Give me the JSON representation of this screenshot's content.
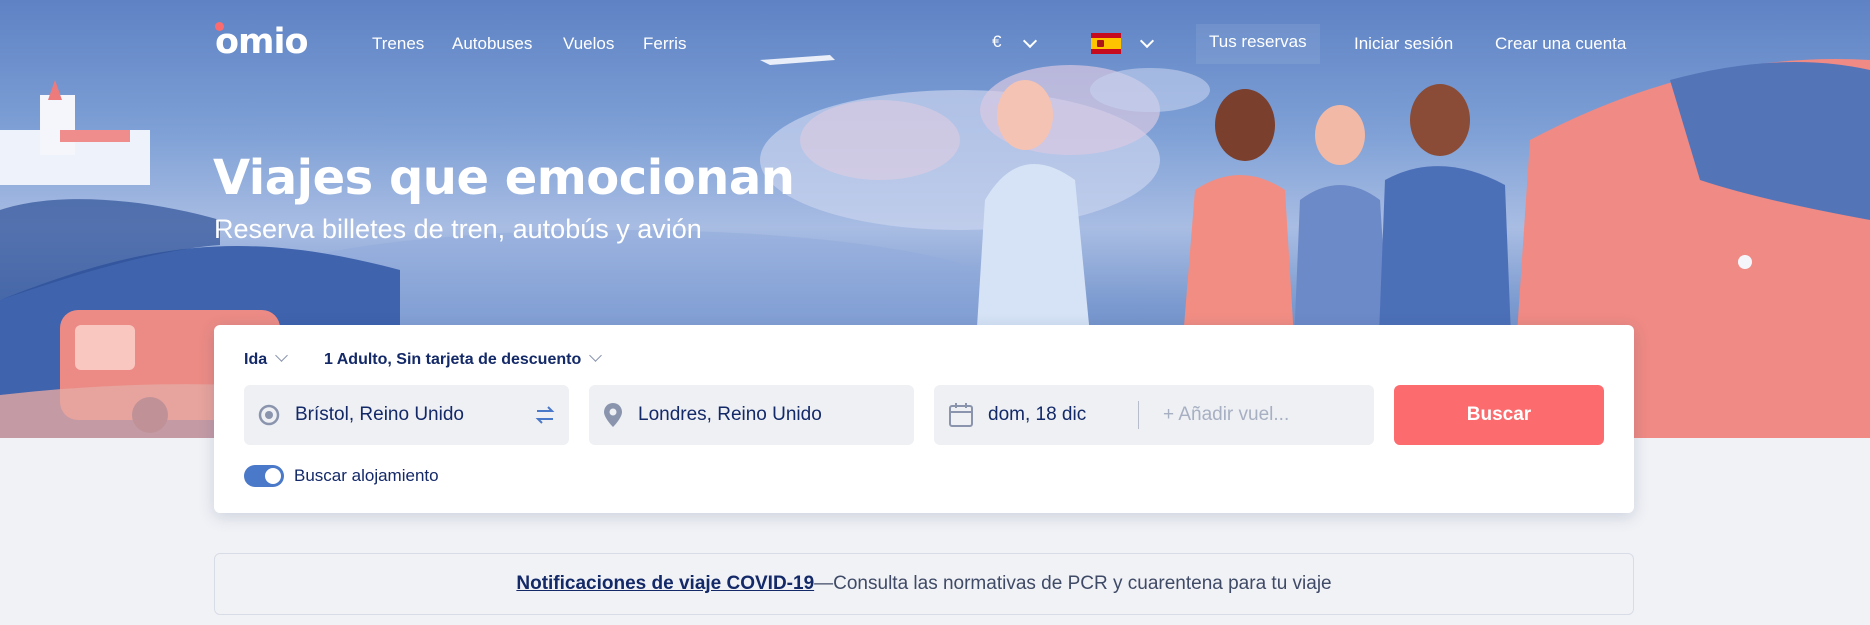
{
  "brand": {
    "name": "omio",
    "accent": "#fc6c6e",
    "navy": "#132968"
  },
  "nav": {
    "links": [
      "Trenes",
      "Autobuses",
      "Vuelos",
      "Ferris"
    ],
    "currency": "€",
    "language_flag": "flag-spain-icon",
    "reservas": "Tus reservas",
    "login": "Iniciar sesión",
    "signup": "Crear una cuenta"
  },
  "hero": {
    "title": "Viajes que emocionan",
    "subtitle": "Reserva billetes de tren, autobús y avión"
  },
  "search": {
    "trip_type": "Ida",
    "passengers": "1 Adulto, Sin tarjeta de descuento",
    "origin": "Brístol, Reino Unido",
    "destination": "Londres, Reino Unido",
    "date": "dom, 18 dic",
    "return_placeholder": "+ Añadir vuel...",
    "button": "Buscar",
    "accommodation_label": "Buscar alojamiento",
    "accommodation_on": true
  },
  "covid": {
    "link": "Notificaciones de viaje COVID-19",
    "text": "—Consulta las normativas de PCR y cuarentena para tu viaje"
  }
}
